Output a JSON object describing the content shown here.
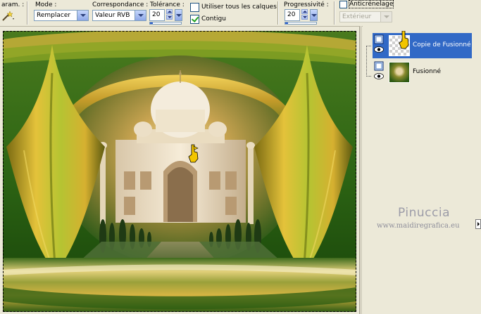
{
  "toolbar": {
    "params_label": "aram. :",
    "mode_label": "Mode :",
    "mode_value": "Remplacer",
    "match_label": "Correspondance :",
    "match_value": "Valeur RVB",
    "tolerance_label": "Tolérance :",
    "tolerance_value": "20",
    "use_all_layers_label": "Utiliser tous les calques",
    "use_all_layers_checked": false,
    "contiguous_label": "Contigu",
    "contiguous_checked": true,
    "feather_label": "Progressivité :",
    "feather_value": "20",
    "antialias_label": "Anticrénelage",
    "antialias_checked": false,
    "antialias_mode_value": "Extérieur"
  },
  "layers": {
    "items": [
      {
        "name": "Copie de Fusionné",
        "selected": true,
        "visible": true
      },
      {
        "name": "Fusionné",
        "selected": false,
        "visible": true
      }
    ]
  },
  "watermark": {
    "name": "Pinuccia",
    "url": "www.maidiregrafica.eu"
  },
  "colors": {
    "selection_highlight": "#3169c6",
    "panel_bg": "#ece9d8",
    "canvas_green": "#1e4a10",
    "gold": "#e7c03a"
  }
}
